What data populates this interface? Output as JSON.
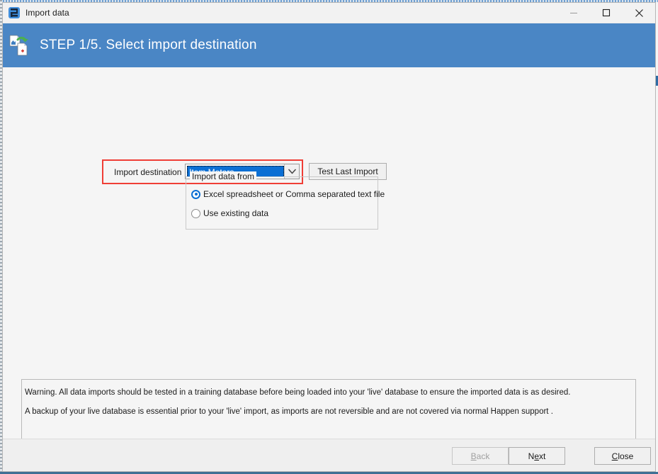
{
  "window": {
    "title": "Import data",
    "icon": "app-icon",
    "controls": {
      "minimize": "minimize-icon",
      "maximize": "maximize-icon",
      "close": "close-icon"
    }
  },
  "header": {
    "title": "STEP 1/5. Select import destination",
    "icon": "import-documents-icon",
    "background_color": "#4a86c5",
    "text_color": "#ffffff"
  },
  "form": {
    "destination_label": "Import destination",
    "destination_value": "Item Meters",
    "destination_dropdown_icon": "chevron-down-icon",
    "test_last_import_label": "Test Last Import",
    "annotation_color": "#ef3e36",
    "group": {
      "legend": "Import data from",
      "options": [
        {
          "label": "Excel spreadsheet or Comma separated text file",
          "selected": true
        },
        {
          "label": "Use existing data",
          "selected": false
        }
      ]
    }
  },
  "warning": {
    "line1": "Warning.  All data imports should be tested in a training database before being loaded into your 'live' database to ensure the imported data is as desired.",
    "line2": "A backup of your live database is essential prior to your 'live' import, as imports are not reversible and are not covered via normal Happen support ."
  },
  "footer": {
    "back": {
      "label": "Back",
      "mnemonic": "B",
      "rest": "ack",
      "enabled": false
    },
    "next": {
      "label": "Next",
      "first": "N",
      "mnemonic": "e",
      "rest": "xt",
      "enabled": true
    },
    "close": {
      "label": "Close",
      "mnemonic": "C",
      "rest": "lose",
      "enabled": true
    }
  }
}
